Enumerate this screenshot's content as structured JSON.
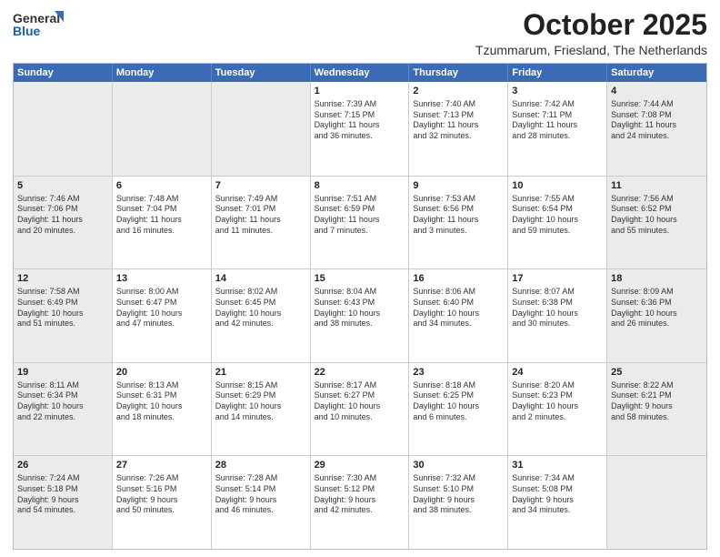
{
  "header": {
    "logo_general": "General",
    "logo_blue": "Blue",
    "title": "October 2025",
    "subtitle": "Tzummarum, Friesland, The Netherlands"
  },
  "weekdays": [
    "Sunday",
    "Monday",
    "Tuesday",
    "Wednesday",
    "Thursday",
    "Friday",
    "Saturday"
  ],
  "weeks": [
    [
      {
        "day": "",
        "info": "",
        "shaded": true
      },
      {
        "day": "",
        "info": "",
        "shaded": true
      },
      {
        "day": "",
        "info": "",
        "shaded": true
      },
      {
        "day": "1",
        "info": "Sunrise: 7:39 AM\nSunset: 7:15 PM\nDaylight: 11 hours\nand 36 minutes."
      },
      {
        "day": "2",
        "info": "Sunrise: 7:40 AM\nSunset: 7:13 PM\nDaylight: 11 hours\nand 32 minutes."
      },
      {
        "day": "3",
        "info": "Sunrise: 7:42 AM\nSunset: 7:11 PM\nDaylight: 11 hours\nand 28 minutes."
      },
      {
        "day": "4",
        "info": "Sunrise: 7:44 AM\nSunset: 7:08 PM\nDaylight: 11 hours\nand 24 minutes.",
        "shaded": true
      }
    ],
    [
      {
        "day": "5",
        "info": "Sunrise: 7:46 AM\nSunset: 7:06 PM\nDaylight: 11 hours\nand 20 minutes.",
        "shaded": true
      },
      {
        "day": "6",
        "info": "Sunrise: 7:48 AM\nSunset: 7:04 PM\nDaylight: 11 hours\nand 16 minutes."
      },
      {
        "day": "7",
        "info": "Sunrise: 7:49 AM\nSunset: 7:01 PM\nDaylight: 11 hours\nand 11 minutes."
      },
      {
        "day": "8",
        "info": "Sunrise: 7:51 AM\nSunset: 6:59 PM\nDaylight: 11 hours\nand 7 minutes."
      },
      {
        "day": "9",
        "info": "Sunrise: 7:53 AM\nSunset: 6:56 PM\nDaylight: 11 hours\nand 3 minutes."
      },
      {
        "day": "10",
        "info": "Sunrise: 7:55 AM\nSunset: 6:54 PM\nDaylight: 10 hours\nand 59 minutes."
      },
      {
        "day": "11",
        "info": "Sunrise: 7:56 AM\nSunset: 6:52 PM\nDaylight: 10 hours\nand 55 minutes.",
        "shaded": true
      }
    ],
    [
      {
        "day": "12",
        "info": "Sunrise: 7:58 AM\nSunset: 6:49 PM\nDaylight: 10 hours\nand 51 minutes.",
        "shaded": true
      },
      {
        "day": "13",
        "info": "Sunrise: 8:00 AM\nSunset: 6:47 PM\nDaylight: 10 hours\nand 47 minutes."
      },
      {
        "day": "14",
        "info": "Sunrise: 8:02 AM\nSunset: 6:45 PM\nDaylight: 10 hours\nand 42 minutes."
      },
      {
        "day": "15",
        "info": "Sunrise: 8:04 AM\nSunset: 6:43 PM\nDaylight: 10 hours\nand 38 minutes."
      },
      {
        "day": "16",
        "info": "Sunrise: 8:06 AM\nSunset: 6:40 PM\nDaylight: 10 hours\nand 34 minutes."
      },
      {
        "day": "17",
        "info": "Sunrise: 8:07 AM\nSunset: 6:38 PM\nDaylight: 10 hours\nand 30 minutes."
      },
      {
        "day": "18",
        "info": "Sunrise: 8:09 AM\nSunset: 6:36 PM\nDaylight: 10 hours\nand 26 minutes.",
        "shaded": true
      }
    ],
    [
      {
        "day": "19",
        "info": "Sunrise: 8:11 AM\nSunset: 6:34 PM\nDaylight: 10 hours\nand 22 minutes.",
        "shaded": true
      },
      {
        "day": "20",
        "info": "Sunrise: 8:13 AM\nSunset: 6:31 PM\nDaylight: 10 hours\nand 18 minutes."
      },
      {
        "day": "21",
        "info": "Sunrise: 8:15 AM\nSunset: 6:29 PM\nDaylight: 10 hours\nand 14 minutes."
      },
      {
        "day": "22",
        "info": "Sunrise: 8:17 AM\nSunset: 6:27 PM\nDaylight: 10 hours\nand 10 minutes."
      },
      {
        "day": "23",
        "info": "Sunrise: 8:18 AM\nSunset: 6:25 PM\nDaylight: 10 hours\nand 6 minutes."
      },
      {
        "day": "24",
        "info": "Sunrise: 8:20 AM\nSunset: 6:23 PM\nDaylight: 10 hours\nand 2 minutes."
      },
      {
        "day": "25",
        "info": "Sunrise: 8:22 AM\nSunset: 6:21 PM\nDaylight: 9 hours\nand 58 minutes.",
        "shaded": true
      }
    ],
    [
      {
        "day": "26",
        "info": "Sunrise: 7:24 AM\nSunset: 5:18 PM\nDaylight: 9 hours\nand 54 minutes.",
        "shaded": true
      },
      {
        "day": "27",
        "info": "Sunrise: 7:26 AM\nSunset: 5:16 PM\nDaylight: 9 hours\nand 50 minutes."
      },
      {
        "day": "28",
        "info": "Sunrise: 7:28 AM\nSunset: 5:14 PM\nDaylight: 9 hours\nand 46 minutes."
      },
      {
        "day": "29",
        "info": "Sunrise: 7:30 AM\nSunset: 5:12 PM\nDaylight: 9 hours\nand 42 minutes."
      },
      {
        "day": "30",
        "info": "Sunrise: 7:32 AM\nSunset: 5:10 PM\nDaylight: 9 hours\nand 38 minutes."
      },
      {
        "day": "31",
        "info": "Sunrise: 7:34 AM\nSunset: 5:08 PM\nDaylight: 9 hours\nand 34 minutes."
      },
      {
        "day": "",
        "info": "",
        "shaded": true
      }
    ]
  ]
}
